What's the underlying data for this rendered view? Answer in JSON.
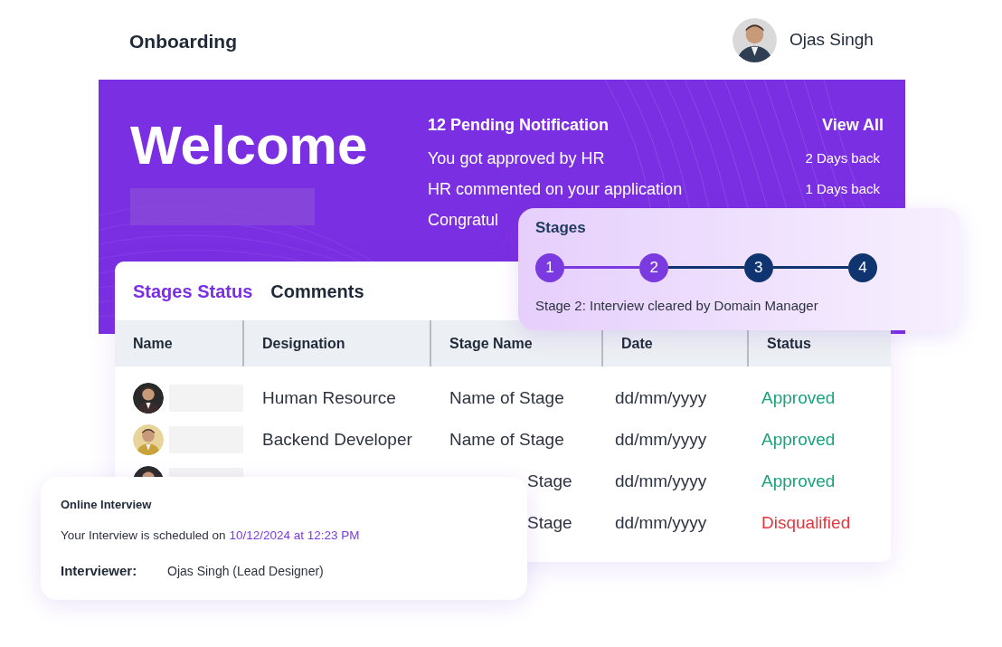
{
  "header": {
    "title": "Onboarding",
    "user": {
      "name": "Ojas Singh"
    }
  },
  "banner": {
    "heading": "Welcome",
    "notifications_title": "12 Pending Notification",
    "view_all": "View All",
    "notifications": [
      {
        "text": "You got approved by HR",
        "time": "2 Days back"
      },
      {
        "text": "HR commented on your application",
        "time": "1 Days back"
      },
      {
        "text": "Congratul"
      }
    ]
  },
  "stages_card": {
    "title": "Stages",
    "steps": [
      {
        "label": "1",
        "done": true
      },
      {
        "label": "2",
        "done": true
      },
      {
        "label": "3",
        "done": false
      },
      {
        "label": "4",
        "done": false
      }
    ],
    "caption": "Stage 2: Interview cleared by Domain Manager"
  },
  "status_card": {
    "tabs": [
      {
        "label": "Stages Status",
        "selected": true
      },
      {
        "label": "Comments",
        "selected": false
      }
    ],
    "columns": [
      "Name",
      "Designation",
      "Stage Name",
      "Date",
      "Status"
    ],
    "rows": [
      {
        "designation": "Human Resource",
        "stage_name": "Name of Stage",
        "date": "dd/mm/yyyy",
        "status": "Approved",
        "kind": "approved"
      },
      {
        "designation": "Backend Developer",
        "stage_name": "Name of Stage",
        "date": "dd/mm/yyyy",
        "status": "Approved",
        "kind": "approved"
      },
      {
        "stage_name": "Stage",
        "date": "dd/mm/yyyy",
        "status": "Approved",
        "kind": "approved"
      },
      {
        "stage_name": "Stage",
        "date": "dd/mm/yyyy",
        "status": "Disqualified",
        "kind": "disqualified"
      }
    ]
  },
  "interview_card": {
    "title": "Online Interview",
    "schedule_text": "Your Interview is scheduled on ",
    "schedule_time": "10/12/2024 at 12:23 PM",
    "interviewer_label": "Interviewer:",
    "interviewer": "Ojas Singh (Lead Designer)"
  }
}
